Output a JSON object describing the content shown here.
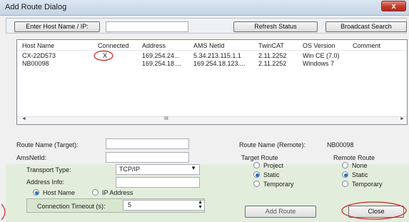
{
  "window": {
    "title": "Add Route Dialog",
    "close_glyph": "x"
  },
  "toolbar": {
    "enter_host_label": "Enter Host Name / IP:",
    "host_value": "",
    "refresh_label": "Refresh Status",
    "broadcast_label": "Broadcast Search"
  },
  "table": {
    "columns": [
      "Host Name",
      "Connected",
      "Address",
      "AMS NetId",
      "TwinCAT",
      "OS Version",
      "Comment"
    ],
    "rows": [
      {
        "host": "CX-22D573",
        "connected": "X",
        "address": "169.254.24...",
        "netid": "5.34.213.115.1.1",
        "twincat": "2.11.2252",
        "os": "Win CE (7.0)",
        "comment": ""
      },
      {
        "host": "NB00098",
        "connected": "",
        "address": "169.254.18....",
        "netid": "169.254.18.123....",
        "twincat": "2.11.2252",
        "os": "Windows 7",
        "comment": ""
      }
    ],
    "scroll_mid": "III",
    "scroll_left": "◄",
    "scroll_right": "►"
  },
  "form": {
    "route_name_target_label": "Route Name (Target):",
    "route_name_target_value": "",
    "route_name_remote_label": "Route Name (Remote):",
    "route_name_remote_value": "NB00098",
    "amsnetid_label": "AmsNetId:",
    "amsnetid_value": "",
    "target_route_label": "Target Route",
    "remote_route_label": "Remote Route",
    "target_options": [
      "Project",
      "Static",
      "Temporary"
    ],
    "remote_options": [
      "None",
      "Static",
      "Temporary"
    ],
    "transport_label": "Transport Type:",
    "transport_value": "TCP/IP",
    "address_info_label": "Address Info:",
    "address_info_value": "",
    "hostname_radio": "Host Name",
    "ip_radio": "IP Address",
    "timeout_label": "Connection Timeout (s):",
    "timeout_value": "5",
    "add_route_label": "Add Route",
    "close_label": "Close"
  },
  "colors": {
    "accent_red": "#c0392b",
    "annotation_red": "#c62828"
  }
}
